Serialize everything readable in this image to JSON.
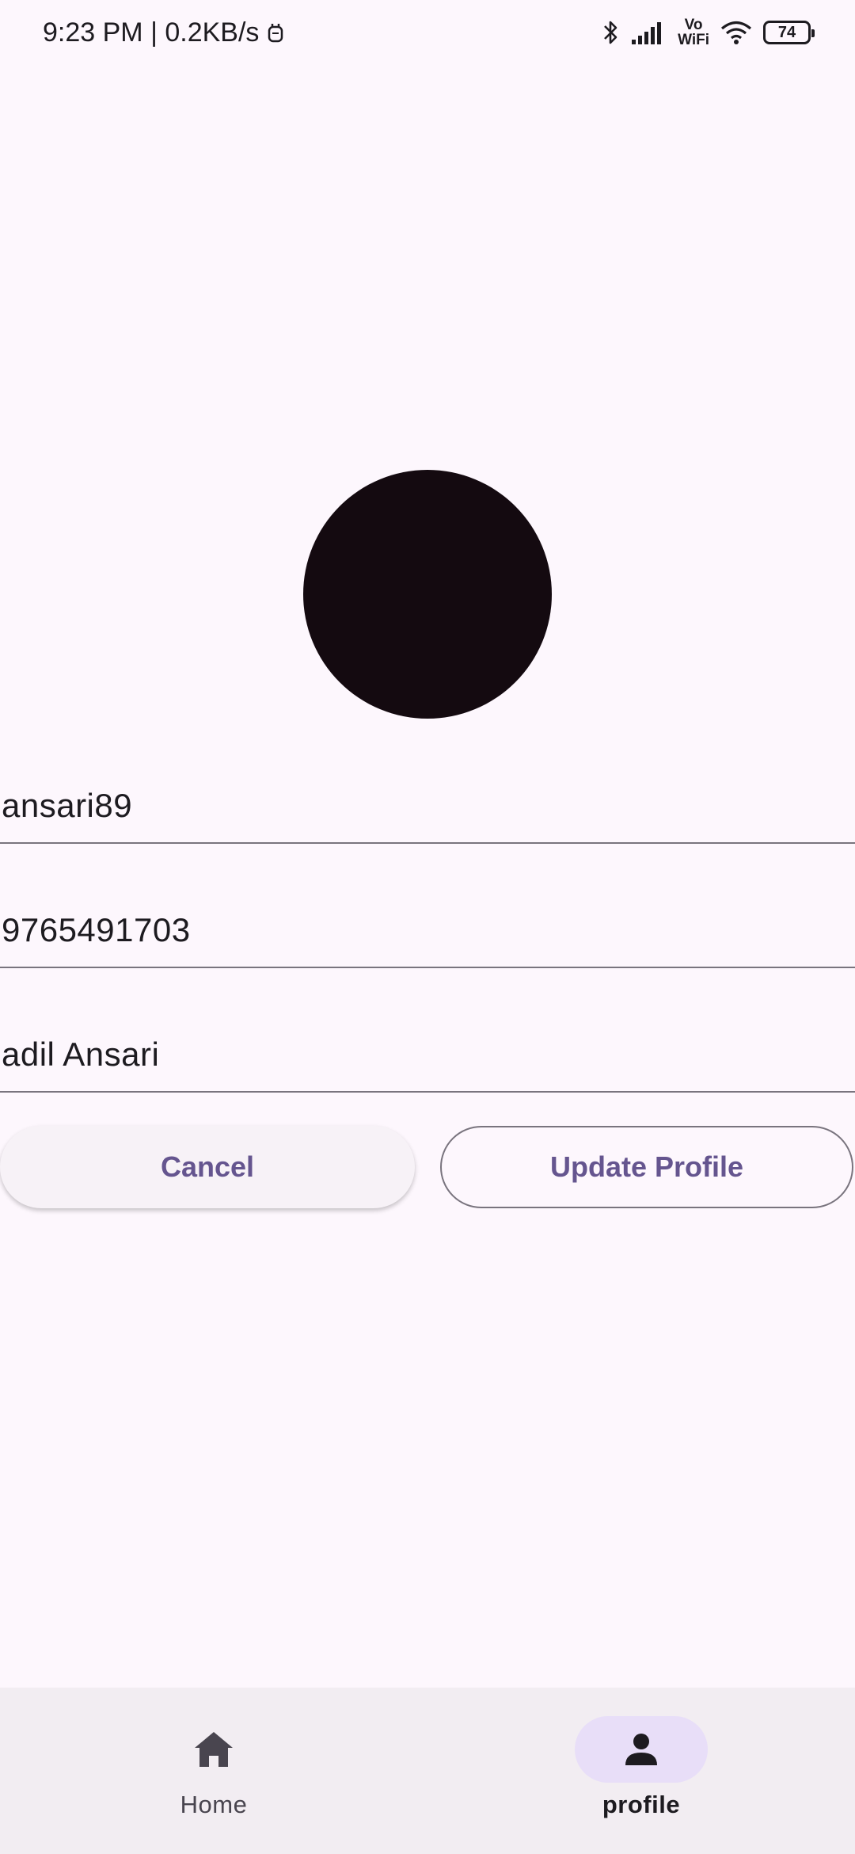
{
  "status_bar": {
    "time_speed": "9:23 PM | 0.2KB/s",
    "vowifi_top": "Vo",
    "vowifi_bottom": "WiFi",
    "battery": "74"
  },
  "form": {
    "username": "ansari89",
    "phone": "9765491703",
    "full_name": "adil Ansari"
  },
  "actions": {
    "cancel_label": "Cancel",
    "update_label": "Update Profile"
  },
  "bottom_nav": {
    "items": [
      {
        "label": "Home",
        "icon": "home-icon",
        "active": false
      },
      {
        "label": "profile",
        "icon": "person-icon",
        "active": true
      }
    ]
  },
  "colors": {
    "background": "#fdf7fd",
    "accent": "#65558f",
    "avatar": "#140a10",
    "nav_active_indicator": "#e8def8",
    "nav_background": "#f2edf2"
  }
}
